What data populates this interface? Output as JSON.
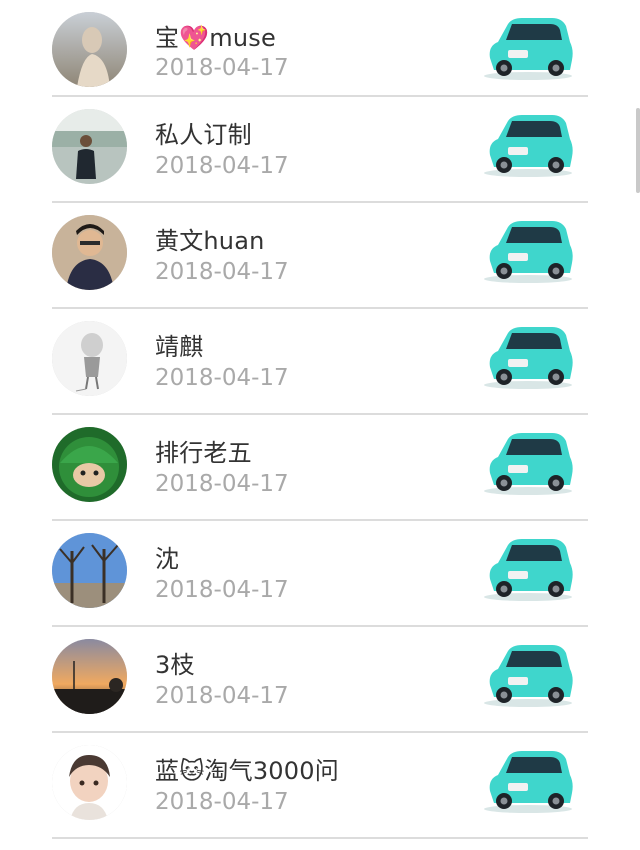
{
  "list": {
    "items": [
      {
        "name": "宝💖muse",
        "date": "2018-04-17",
        "avatar": "girl-silhouette-sky"
      },
      {
        "name": "私人订制",
        "date": "2018-04-17",
        "avatar": "man-by-lake"
      },
      {
        "name": "黄文huan",
        "date": "2018-04-17",
        "avatar": "man-with-glasses"
      },
      {
        "name": "靖麒",
        "date": "2018-04-17",
        "avatar": "sketch-girl"
      },
      {
        "name": "排行老五",
        "date": "2018-04-17",
        "avatar": "green-helmet-cartoon"
      },
      {
        "name": "沈",
        "date": "2018-04-17",
        "avatar": "trees-blue-sky"
      },
      {
        "name": "3枝",
        "date": "2018-04-17",
        "avatar": "sunset-landscape"
      },
      {
        "name": "蓝🐱淘气3000问",
        "date": "2018-04-17",
        "avatar": "cartoon-boy"
      }
    ]
  },
  "colors": {
    "car_body": "#3fd6cc",
    "divider": "#dcdcdc",
    "name_text": "#333333",
    "date_text": "#a9a9a9"
  }
}
